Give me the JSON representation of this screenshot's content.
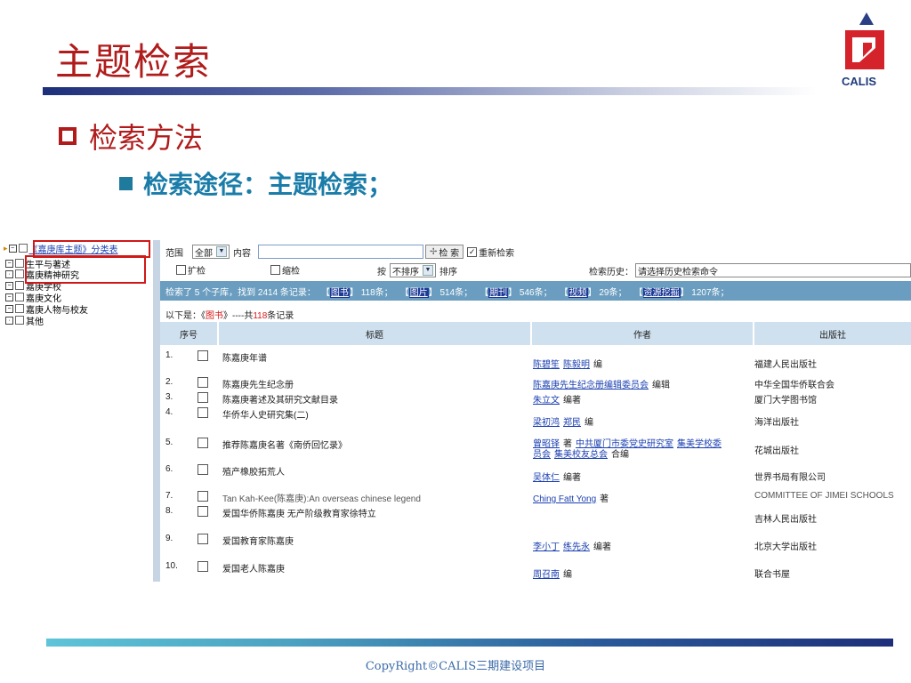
{
  "slide": {
    "title": "主题检索",
    "bullet1": "检索方法",
    "bullet2": "检索途径：主题检索；",
    "footer": "CopyRight©CALIS三期建设项目",
    "logo_text": "CALIS",
    "title_color": "#b01b1b",
    "accent_color": "#1a7ca8"
  },
  "tree": {
    "root": "《嘉庚库主题》分类表",
    "items": [
      "生平与著述",
      "嘉庚精神研究",
      "嘉庚学校",
      "嘉庚文化",
      "嘉庚人物与校友",
      "其他"
    ],
    "toggle_minus": "−",
    "toggle_dot": "·"
  },
  "search": {
    "scope_label": "范围",
    "scope_value": "全部",
    "content_label": "内容",
    "search_button": "检 索",
    "button_icon": "✢",
    "recheck_label": "重新检索",
    "expand_label": "扩检",
    "narrow_label": "缩检",
    "by_label": "按",
    "sort_value": "不排序",
    "sort_label": "排序",
    "history_label": "检索历史：",
    "history_value": "请选择历史检索命令",
    "check_mark": "✓",
    "dropdown_arrow": "▼"
  },
  "summary": {
    "prefix": "检索了 5 个子库，找到 2414 条记录：",
    "groups": [
      {
        "label": "图书",
        "count": "118条；"
      },
      {
        "label": "图片",
        "count": "514条；"
      },
      {
        "label": "期刊",
        "count": "546条；"
      },
      {
        "label": "视频",
        "count": "29条；"
      },
      {
        "label": "资源挖掘",
        "count": "1207条；"
      }
    ]
  },
  "results_line": {
    "prefix": "以下是：《",
    "link": "图书",
    "middle": "》----共",
    "count": "118",
    "suffix": "条记录"
  },
  "table": {
    "headers": [
      "序号",
      "标题",
      "作者",
      "出版社"
    ],
    "rows": [
      {
        "num": "1.",
        "title": "陈嘉庚年谱",
        "authors": [
          "陈碧笙",
          "陈毅明"
        ],
        "role": "编",
        "publisher": "福建人民出版社"
      },
      {
        "num": "2.",
        "title": "陈嘉庚先生纪念册",
        "authors": [
          "陈嘉庚先生纪念册编辑委员会"
        ],
        "role": "编辑",
        "publisher": "中华全国华侨联合会"
      },
      {
        "num": "3.",
        "title": "陈嘉庚著述及其研究文献目录",
        "authors": [
          "朱立文"
        ],
        "role": "编著",
        "publisher": "厦门大学图书馆"
      },
      {
        "num": "4.",
        "title": "华侨华人史研究集(二)",
        "authors": [
          "梁初鸿",
          "郑民"
        ],
        "role": "编",
        "publisher": "海洋出版社"
      },
      {
        "num": "5.",
        "title": "推荐陈嘉庚名著《南侨回忆录》",
        "authors_line1": [
          "曾昭铎"
        ],
        "role1": "著",
        "authors_line1b": [
          "中共厦门市委党史研究室",
          "集美学校委"
        ],
        "authors_line2": [
          "员会",
          "集美校友总会"
        ],
        "role2": "合编",
        "publisher": "花城出版社"
      },
      {
        "num": "6.",
        "title": "殖产橡胶拓荒人",
        "authors": [
          "吴体仁"
        ],
        "role": "编著",
        "publisher": "世界书局有限公司"
      },
      {
        "num": "7.",
        "title": "Tan Kah-Kee(陈嘉庚):An overseas chinese legend",
        "authors": [
          "Ching Fatt Yong"
        ],
        "role": "著",
        "publisher": "COMMITTEE OF JIMEI SCHOOLS"
      },
      {
        "num": "8.",
        "title": "爱国华侨陈嘉庚 无产阶级教育家徐特立",
        "authors": [],
        "role": "",
        "publisher": "吉林人民出版社"
      },
      {
        "num": "9.",
        "title": "爱国教育家陈嘉庚",
        "authors": [
          "李小丁",
          "练先永"
        ],
        "role": "编著",
        "publisher": "北京大学出版社"
      },
      {
        "num": "10.",
        "title": "爱国老人陈嘉庚",
        "authors": [
          "周召南"
        ],
        "role": "编",
        "publisher": "联合书屋"
      }
    ]
  }
}
